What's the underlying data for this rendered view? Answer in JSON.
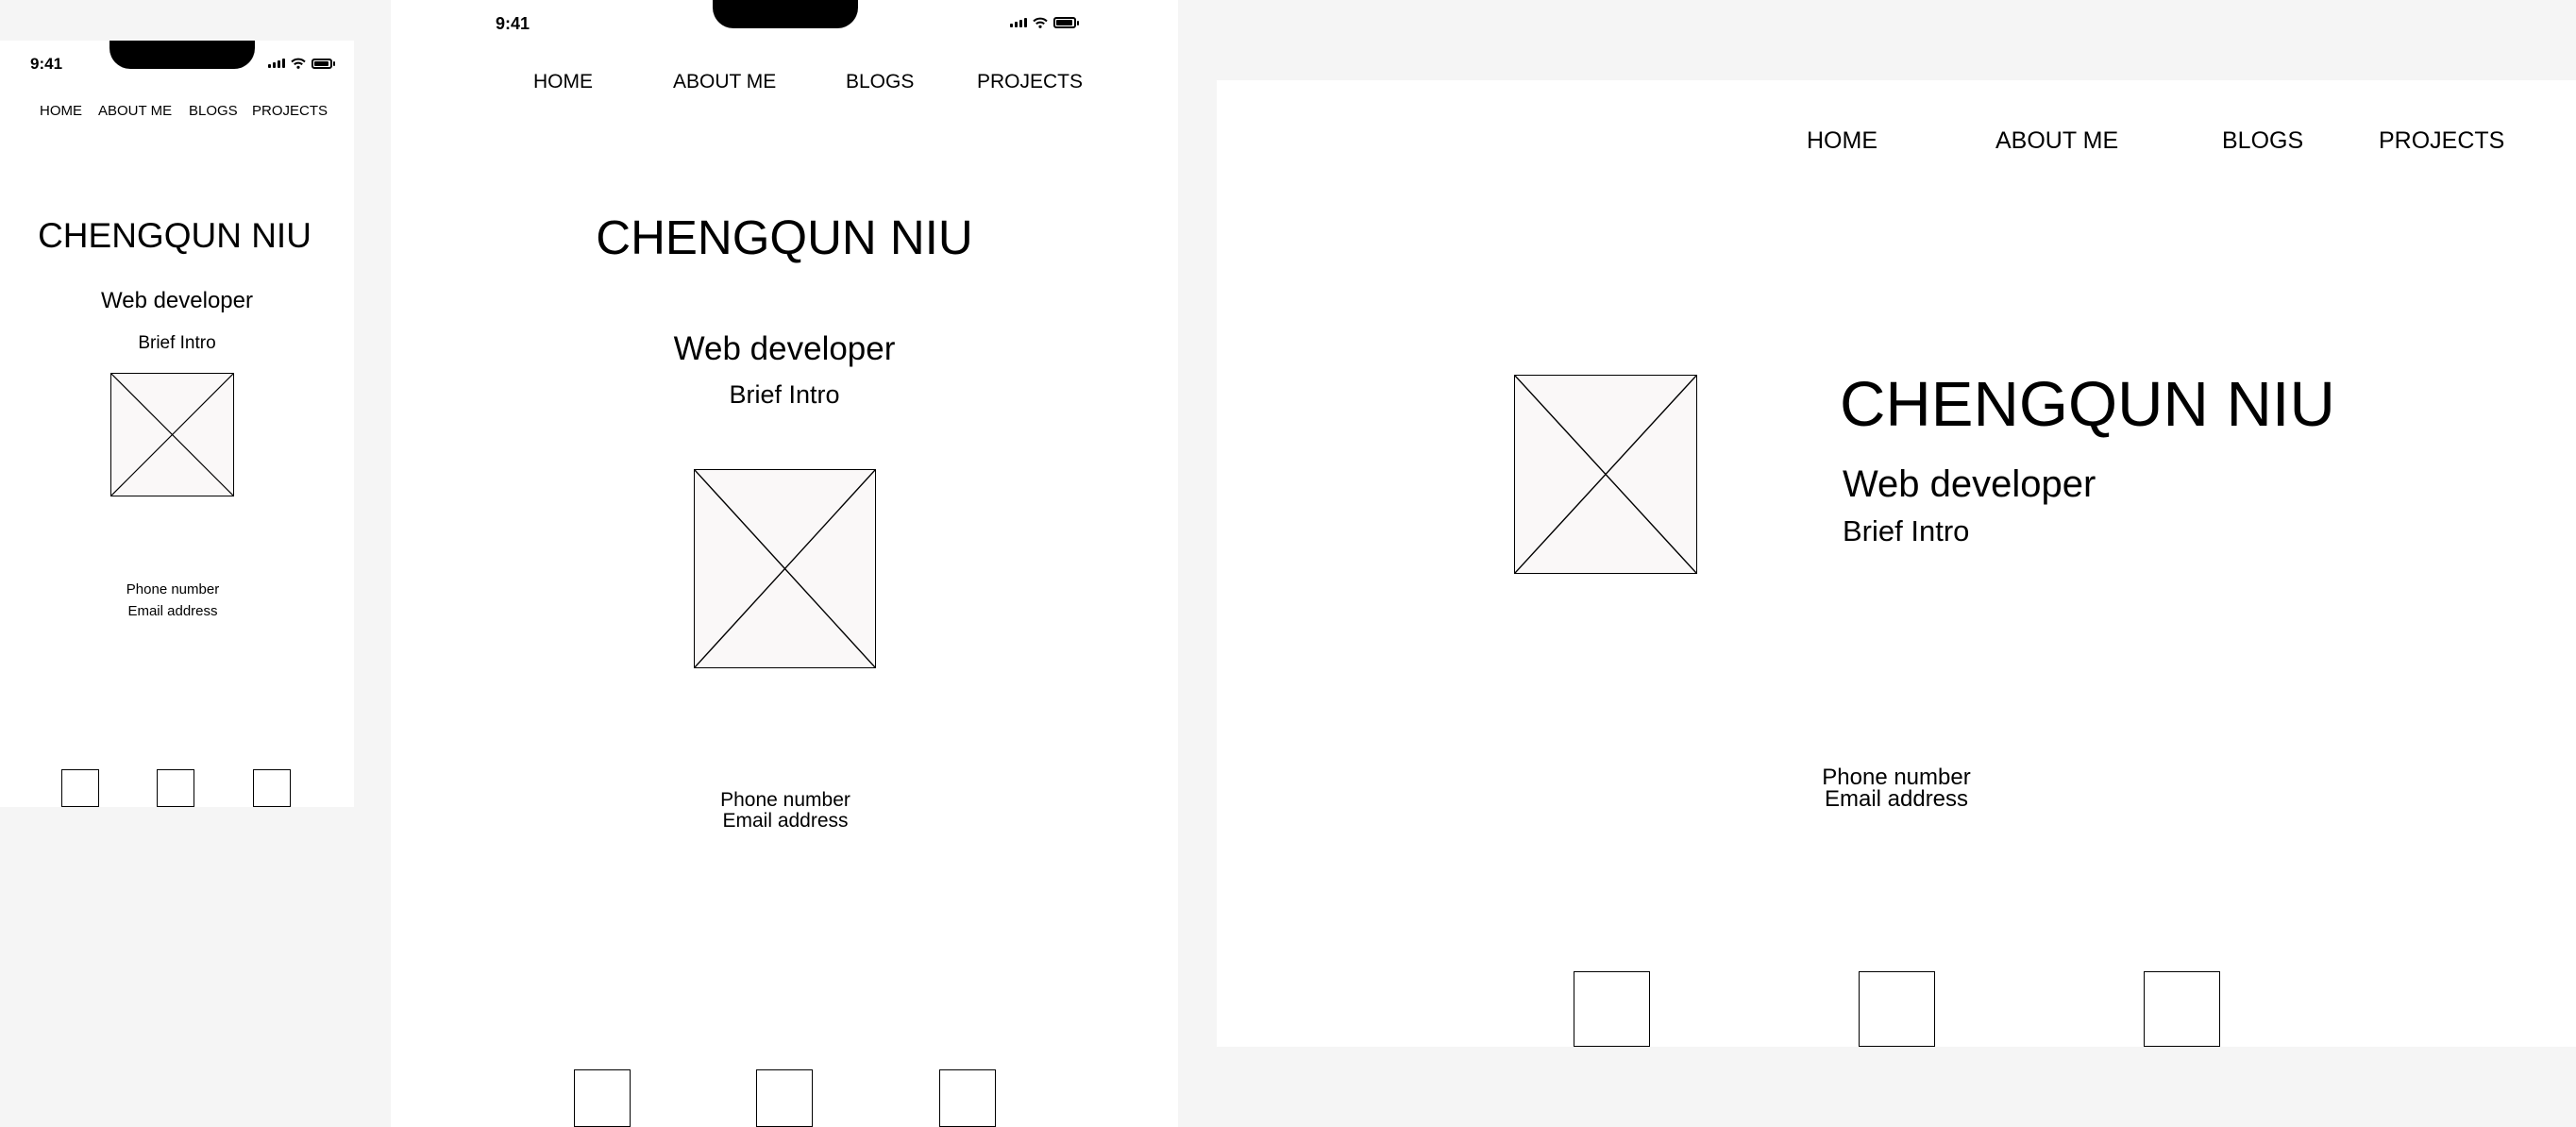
{
  "status_bar": {
    "time": "9:41"
  },
  "nav": {
    "home": "HOME",
    "about": "ABOUT ME",
    "blogs": "BLOGS",
    "projects": "PROJECTS"
  },
  "hero": {
    "name": "CHENGQUN NIU",
    "role": "Web developer",
    "intro": "Brief Intro"
  },
  "contact": {
    "phone": "Phone number",
    "email": "Email address"
  },
  "icons": {
    "status": [
      "signal-icon",
      "wifi-icon",
      "battery-icon"
    ],
    "image": "image-placeholder-icon",
    "social": [
      "social-icon-1",
      "social-icon-2",
      "social-icon-3"
    ]
  }
}
